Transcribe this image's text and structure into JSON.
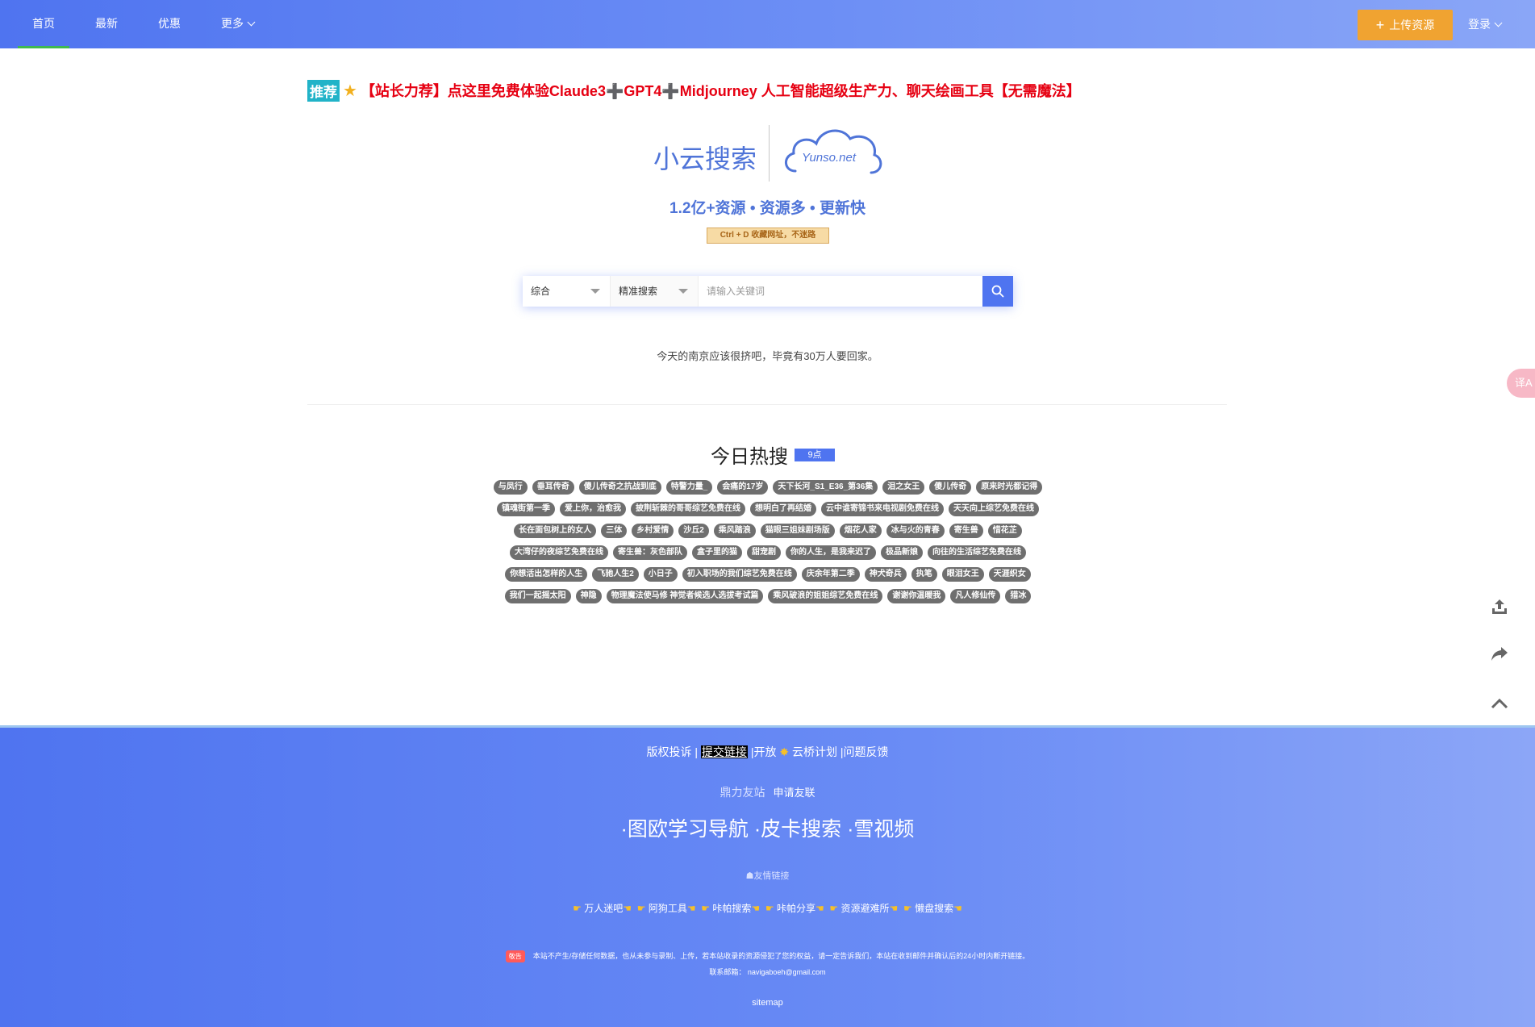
{
  "nav": {
    "items": [
      {
        "label": "首页"
      },
      {
        "label": "最新"
      },
      {
        "label": "优惠"
      },
      {
        "label": "更多"
      }
    ],
    "upload_label": "上传资源",
    "login_label": "登录"
  },
  "promo": {
    "tag": "推荐",
    "text": "【站长力荐】点这里免费体验Claude3➕GPT4➕Midjourney 人工智能超级生产力、聊天绘画工具【无需魔法】"
  },
  "logo": {
    "cn": "小云搜索",
    "en": "Yunso.net"
  },
  "tagline": "1.2亿+资源 • 资源多 • 更新快",
  "ctrl_tip": "Ctrl + D 收藏网址，不迷路",
  "search": {
    "type_value": "综合",
    "mode_value": "精准搜索",
    "placeholder": "请输入关键词"
  },
  "quote": "今天的南京应该很挤吧，毕竟有30万人要回家。",
  "side_button": "译A",
  "hot": {
    "title": "今日热搜",
    "time": "9点",
    "rows": [
      [
        "与凤行",
        "垂耳传奇",
        "傻儿传奇之抗战到底",
        "特警力量_",
        "会痛的17岁",
        "天下长河_S1_E36_第36集",
        "泪之女王",
        "傻儿传奇",
        "原来时光都记得"
      ],
      [
        "镇魂街第一季",
        "爱上你，治愈我",
        "披荆斩棘的哥哥综艺免费在线",
        "想明白了再结婚",
        "云中谁寄锦书来电视剧免费在线",
        "天天向上综艺免费在线"
      ],
      [
        "长在面包树上的女人",
        "三体",
        "乡村爱情",
        "沙丘2",
        "乘风踏浪",
        "猫眼三姐妹剧场版",
        "烟花人家",
        "冰与火的青春",
        "寄生兽",
        "惜花芷"
      ],
      [
        "大湾仔的夜综艺免费在线",
        "寄生兽：灰色部队",
        "盒子里的猫",
        "甜宠剧",
        "你的人生，是我来迟了",
        "极品新娘",
        "向往的生活综艺免费在线"
      ],
      [
        "你想活出怎样的人生",
        "飞驰人生2",
        "小日子",
        "初入职场的我们综艺免费在线",
        "庆余年第二季",
        "神犬奇兵",
        "执笔",
        "眼泪女王",
        "天涯织女"
      ],
      [
        "我们一起摇太阳",
        "神隐",
        "物理魔法使马修 神觉者候选人选拔考试篇",
        "乘风破浪的姐姐综艺免费在线",
        "谢谢你温暖我",
        "凡人修仙传",
        "猎冰"
      ]
    ]
  },
  "footer": {
    "links": [
      {
        "label": "版权投诉"
      },
      {
        "label": "提交链接"
      },
      {
        "label": "开放"
      },
      {
        "label": "云桥计划"
      },
      {
        "label": "问题反馈"
      }
    ],
    "friends_label": "鼎力友站",
    "apply_label": "申请友联",
    "big_links": [
      {
        "label": "·图欧学习导航"
      },
      {
        "label": "·皮卡搜索"
      },
      {
        "label": "·雪视频"
      }
    ],
    "friend_links_label": "友情链接",
    "small_links": [
      {
        "label": "万人迷吧"
      },
      {
        "label": "阿狗工具"
      },
      {
        "label": "咔帕搜索"
      },
      {
        "label": "咔帕分享"
      },
      {
        "label": "资源避难所"
      },
      {
        "label": "懒盘搜索"
      }
    ],
    "disclaimer_badge": "敬告",
    "disclaimer": "本站不产生/存储任何数据，也从未参与录制、上传，若本站收录的资源侵犯了您的权益，请一定告诉我们，本站在收到邮件并确认后的24小时内断开链接。",
    "email_label": "联系邮箱：",
    "email": "navigaboeh@gmail.com",
    "sitemap": "sitemap"
  },
  "colors": {
    "header_gradient_start": "#4f74f0",
    "header_gradient_end": "#8aa6f7",
    "upload_button": "#f0a331",
    "active_underline": "#3fb950",
    "promo_red": "#e60012",
    "brand_blue": "#4f74d8",
    "tag_gray": "#6f6f6f"
  }
}
